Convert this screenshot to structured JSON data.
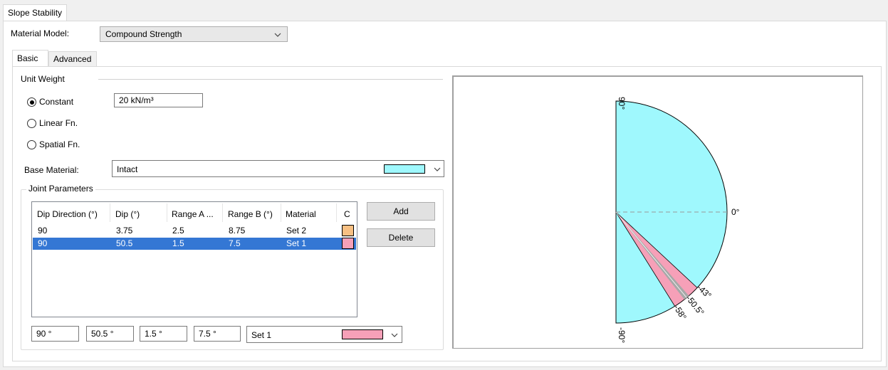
{
  "window": {
    "tab_title": "Slope Stability"
  },
  "material_model": {
    "label": "Material Model:",
    "value": "Compound Strength"
  },
  "tabs": [
    {
      "label": "Basic"
    },
    {
      "label": "Advanced"
    }
  ],
  "unit_weight": {
    "title": "Unit Weight",
    "options": [
      {
        "label": "Constant"
      },
      {
        "label": "Linear Fn."
      },
      {
        "label": "Spatial Fn."
      }
    ],
    "selected": "Constant",
    "value": "20 kN/m³"
  },
  "base_material": {
    "label": "Base Material:",
    "value": "Intact",
    "color": "#9ff8fd"
  },
  "joint_parameters": {
    "title": "Joint Parameters",
    "columns": [
      "Dip Direction (°)",
      "Dip (°)",
      "Range A ...",
      "Range B (°)",
      "Material",
      "C"
    ],
    "rows": [
      {
        "dip_direction": "90",
        "dip": "3.75",
        "range_a": "2.5",
        "range_b": "8.75",
        "material": "Set 2",
        "color": "#f8c083"
      },
      {
        "dip_direction": "90",
        "dip": "50.5",
        "range_a": "1.5",
        "range_b": "7.5",
        "material": "Set 1",
        "color": "#f6a0b8"
      }
    ],
    "selected_row": 1,
    "add_label": "Add",
    "delete_label": "Delete",
    "edit": {
      "dip_direction": "90 °",
      "dip": "50.5 °",
      "range_a": "1.5 °",
      "range_b": "7.5 °",
      "material": "Set 1",
      "material_color": "#f6a0b8"
    }
  },
  "stereo_plot": {
    "labels": {
      "top": "90°",
      "right": "0°",
      "bottom": "-90°",
      "a": "-43°",
      "b": "-50.5°",
      "c": "-58°"
    },
    "wedge": {
      "center_deg": -50.5,
      "range_deg": 7.5,
      "core_half_deg": 1.5
    },
    "colors": {
      "semicircle": "#9ff8fd",
      "wedge": "#f6a0b8",
      "core": "#a8a8a8"
    }
  }
}
